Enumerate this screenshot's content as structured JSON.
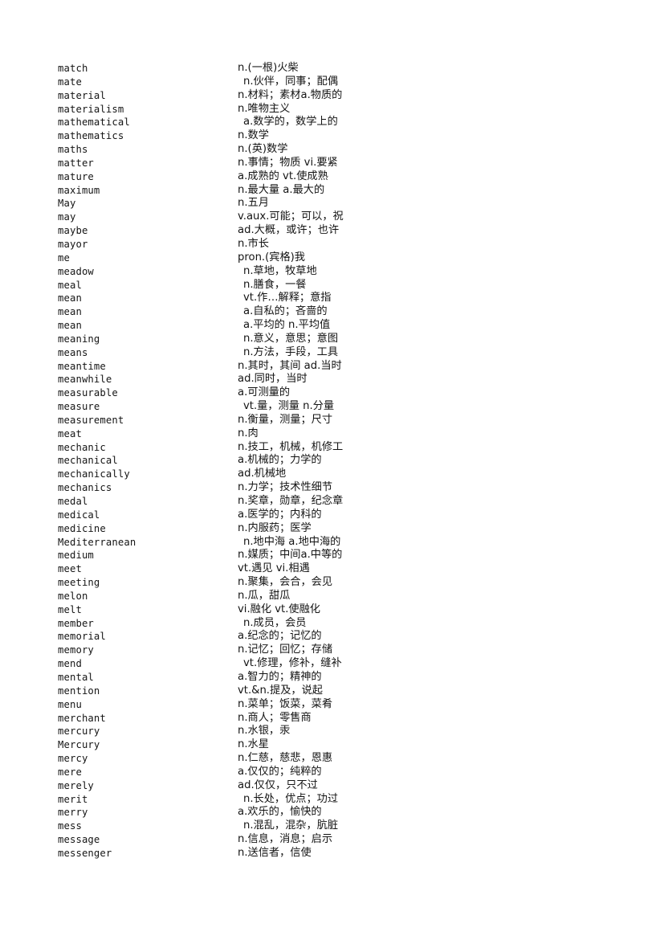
{
  "document": {
    "type": "vocabulary-glossary",
    "script_hint": "English headword with Chinese definition",
    "section_letter": "M",
    "columns": {
      "headword": "word",
      "definition": "definition"
    },
    "entry_count": 59
  },
  "entries": [
    {
      "word": "match",
      "definition": "n.(一根)火柴",
      "indent": false
    },
    {
      "word": "mate",
      "definition": "n.伙伴，同事；配偶",
      "indent": true
    },
    {
      "word": "material",
      "definition": "n.材料；素材a.物质的",
      "indent": false
    },
    {
      "word": "materialism",
      "definition": "n.唯物主义",
      "indent": false
    },
    {
      "word": "mathematical",
      "definition": "a.数学的，数学上的",
      "indent": true
    },
    {
      "word": "mathematics",
      "definition": "n.数学",
      "indent": false
    },
    {
      "word": "maths",
      "definition": "n.(英)数学",
      "indent": false
    },
    {
      "word": "matter",
      "definition": "n.事情；物质 vi.要紧",
      "indent": false
    },
    {
      "word": "mature",
      "definition": "a.成熟的 vt.使成熟",
      "indent": false
    },
    {
      "word": "maximum",
      "definition": "n.最大量 a.最大的",
      "indent": false
    },
    {
      "word": "May",
      "definition": "n.五月",
      "indent": false
    },
    {
      "word": "may",
      "definition": "v.aux.可能；可以，祝",
      "indent": false
    },
    {
      "word": "maybe",
      "definition": "ad.大概，或许；也许",
      "indent": false
    },
    {
      "word": "mayor",
      "definition": "n.市长",
      "indent": false
    },
    {
      "word": "me",
      "definition": "pron.(宾格)我",
      "indent": false
    },
    {
      "word": "meadow",
      "definition": "n.草地，牧草地",
      "indent": true
    },
    {
      "word": "meal",
      "definition": "n.膳食，一餐",
      "indent": true
    },
    {
      "word": "mean",
      "definition": "vt.作…解释；意指",
      "indent": true
    },
    {
      "word": "mean",
      "definition": "a.自私的；吝啬的",
      "indent": true
    },
    {
      "word": "mean",
      "definition": "a.平均的 n.平均值",
      "indent": true
    },
    {
      "word": "meaning",
      "definition": "n.意义，意思；意图",
      "indent": true
    },
    {
      "word": "means",
      "definition": "n.方法，手段，工具",
      "indent": true
    },
    {
      "word": "meantime",
      "definition": "n.其时，其间 ad.当时",
      "indent": false
    },
    {
      "word": "meanwhile",
      "definition": "ad.同时，当时",
      "indent": false
    },
    {
      "word": "measurable",
      "definition": "a.可测量的",
      "indent": false
    },
    {
      "word": "measure",
      "definition": "vt.量，测量 n.分量",
      "indent": true
    },
    {
      "word": "measurement",
      "definition": "n.衡量，测量；尺寸",
      "indent": false
    },
    {
      "word": "meat",
      "definition": "n.肉",
      "indent": false
    },
    {
      "word": "mechanic",
      "definition": "n.技工，机械，机修工",
      "indent": false
    },
    {
      "word": "mechanical",
      "definition": "a.机械的；力学的",
      "indent": false
    },
    {
      "word": "mechanically",
      "definition": "ad.机械地",
      "indent": false
    },
    {
      "word": "mechanics",
      "definition": "n.力学；技术性细节",
      "indent": false
    },
    {
      "word": "medal",
      "definition": "n.奖章，勋章，纪念章",
      "indent": false
    },
    {
      "word": "medical",
      "definition": "a.医学的；内科的",
      "indent": false
    },
    {
      "word": "medicine",
      "definition": "n.内服药；医学",
      "indent": false
    },
    {
      "word": "Mediterranean",
      "definition": "n.地中海 a.地中海的",
      "indent": true
    },
    {
      "word": "medium",
      "definition": "n.媒质；中间a.中等的",
      "indent": false
    },
    {
      "word": "meet",
      "definition": "vt.遇见 vi.相遇",
      "indent": false
    },
    {
      "word": "meeting",
      "definition": "n.聚集，会合，会见",
      "indent": false
    },
    {
      "word": "melon",
      "definition": "n.瓜，甜瓜",
      "indent": false
    },
    {
      "word": "melt",
      "definition": "vi.融化 vt.使融化",
      "indent": false
    },
    {
      "word": "member",
      "definition": "n.成员，会员",
      "indent": true
    },
    {
      "word": "memorial",
      "definition": "a.纪念的；记忆的",
      "indent": false
    },
    {
      "word": "memory",
      "definition": "n.记忆；回忆；存储",
      "indent": false
    },
    {
      "word": "mend",
      "definition": "vt.修理，修补，缝补",
      "indent": true
    },
    {
      "word": "mental",
      "definition": "a.智力的；精神的",
      "indent": false
    },
    {
      "word": "mention",
      "definition": "vt.&n.提及，说起",
      "indent": false
    },
    {
      "word": "menu",
      "definition": "n.菜单；饭菜，菜肴",
      "indent": false
    },
    {
      "word": "merchant",
      "definition": "n.商人；零售商",
      "indent": false
    },
    {
      "word": "mercury",
      "definition": "n.水银，汞",
      "indent": false
    },
    {
      "word": "Mercury",
      "definition": "n.水星",
      "indent": false
    },
    {
      "word": "mercy",
      "definition": "n.仁慈，慈悲，恩惠",
      "indent": false
    },
    {
      "word": "mere",
      "definition": "a.仅仅的；纯粹的",
      "indent": false
    },
    {
      "word": "merely",
      "definition": "ad.仅仅，只不过",
      "indent": false
    },
    {
      "word": "merit",
      "definition": "n.长处，优点；功过",
      "indent": true
    },
    {
      "word": "merry",
      "definition": "a.欢乐的，愉快的",
      "indent": false
    },
    {
      "word": "mess",
      "definition": "n.混乱，混杂，肮脏",
      "indent": true
    },
    {
      "word": "message",
      "definition": "n.信息，消息；启示",
      "indent": false
    },
    {
      "word": "messenger",
      "definition": "n.送信者，信使",
      "indent": false
    }
  ]
}
